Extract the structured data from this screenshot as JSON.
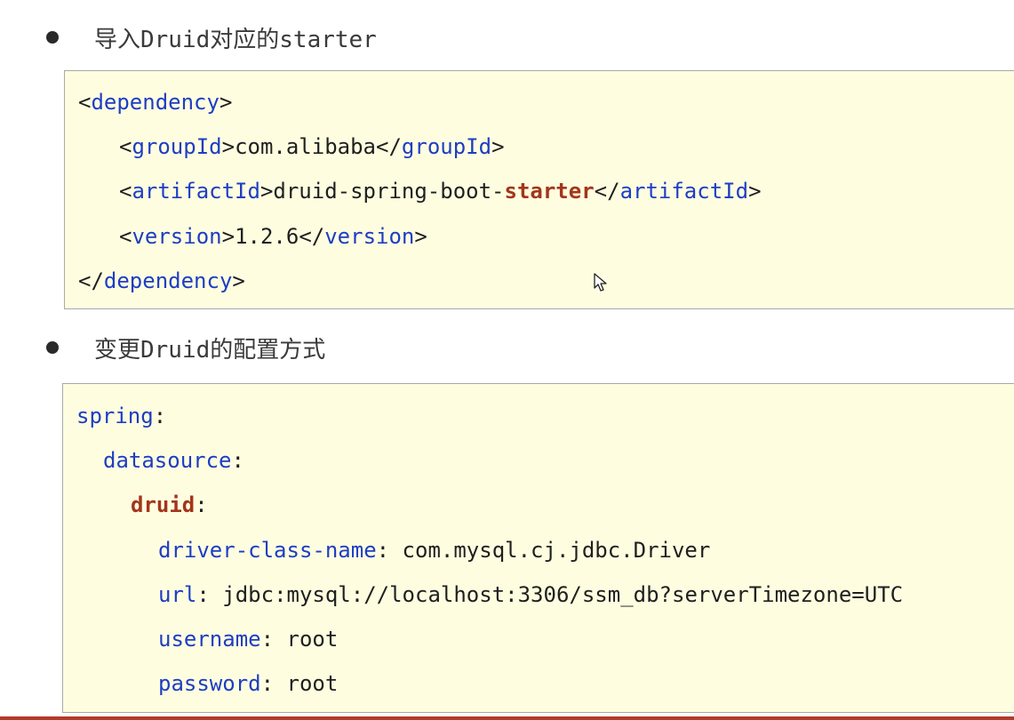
{
  "section1": {
    "bullet_text": "导入Druid对应的starter",
    "dependency": {
      "open_tag": "dependency",
      "group_tag": "groupId",
      "group_value": "com.alibaba",
      "artifact_tag": "artifactId",
      "artifact_value_prefix": "druid-spring-boot-",
      "artifact_value_highlight": "starter",
      "version_tag": "version",
      "version_value": "1.2.6"
    }
  },
  "section2": {
    "bullet_text": "变更Druid的配置方式",
    "yaml": {
      "spring_key": "spring",
      "datasource_key": "datasource",
      "druid_key": "druid",
      "driver_key": "driver-class-name",
      "driver_value": "com.mysql.cj.jdbc.Driver",
      "url_key": "url",
      "url_value": "jdbc:mysql://localhost:3306/ssm_db?serverTimezone=UTC",
      "username_key": "username",
      "username_value": "root",
      "password_key": "password",
      "password_value": "root"
    }
  },
  "colors": {
    "tag": "#1d3ec4",
    "highlight": "#a2361b",
    "code_background": "#fffde0"
  },
  "icons": [
    "bullet-dot",
    "mouse-pointer-icon"
  ]
}
